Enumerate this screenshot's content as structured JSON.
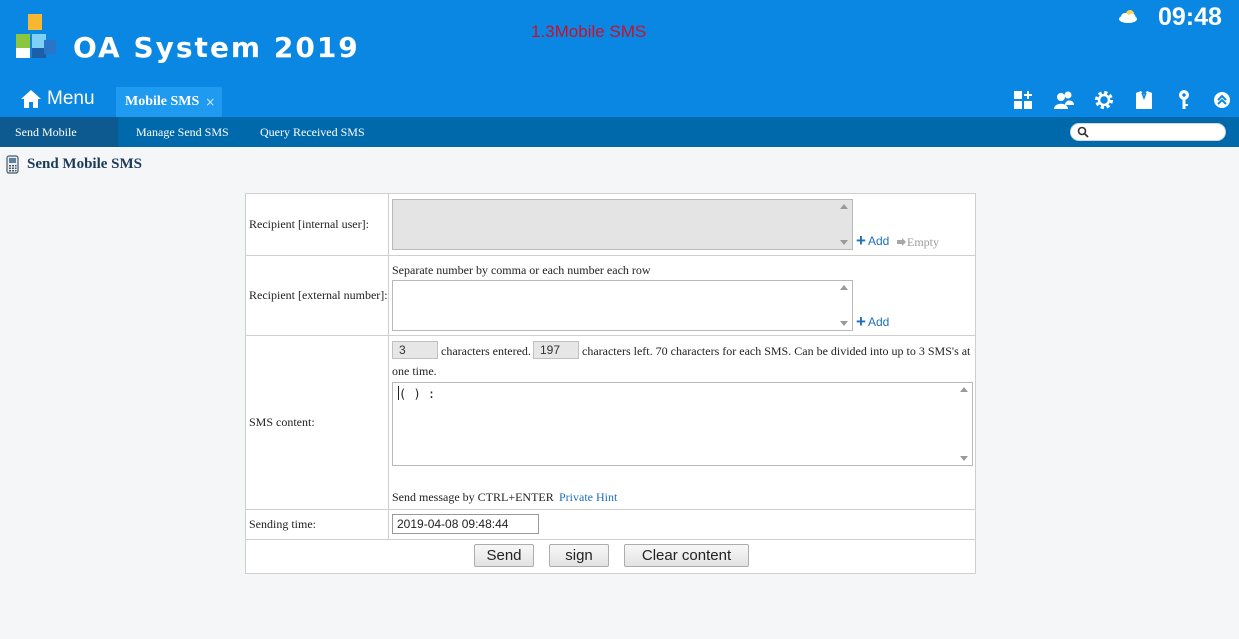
{
  "header": {
    "app_title": "OA System 2019",
    "watermark": "1.3Mobile SMS",
    "clock": "09:48",
    "menu_label": "Menu",
    "active_tab": "Mobile SMS",
    "tab_close": "×",
    "icons": [
      "weather-icon",
      "apps-icon",
      "users-icon",
      "settings-icon",
      "shirt-icon",
      "key-icon",
      "collapse-icon"
    ]
  },
  "subnav": {
    "items": [
      {
        "label": "Send Mobile SMS"
      },
      {
        "label": "Manage Send SMS"
      },
      {
        "label": "Query Received SMS"
      }
    ],
    "search_placeholder": ""
  },
  "page": {
    "title": "Send Mobile SMS"
  },
  "form": {
    "internal_label": "Recipient [internal user]:",
    "external_label": "Recipient [external number]:",
    "external_hint": "Separate number by comma or each number each row",
    "add_label": "Add",
    "empty_label": "Empty",
    "content_label": "SMS content:",
    "chars_entered": "3",
    "chars_entered_text": "characters entered.",
    "chars_left": "197",
    "chars_left_text": "characters left. 70 characters for each SMS. Can be divided into up to 3 SMS's at",
    "chars_left_text2": "one time.",
    "content_value": "( ) :",
    "send_hint": "Send message by CTRL+ENTER",
    "private_hint": "Private Hint",
    "time_label": "Sending time:",
    "time_value": "2019-04-08 09:48:44"
  },
  "buttons": {
    "send": "Send",
    "sign": "sign",
    "clear": "Clear content"
  },
  "colors": {
    "header_bg": "#0a87e3",
    "subnav_bg": "#0069ab",
    "tab_active_bg": "#1e9af0",
    "link": "#1d6fbf",
    "watermark": "#c8102e"
  }
}
